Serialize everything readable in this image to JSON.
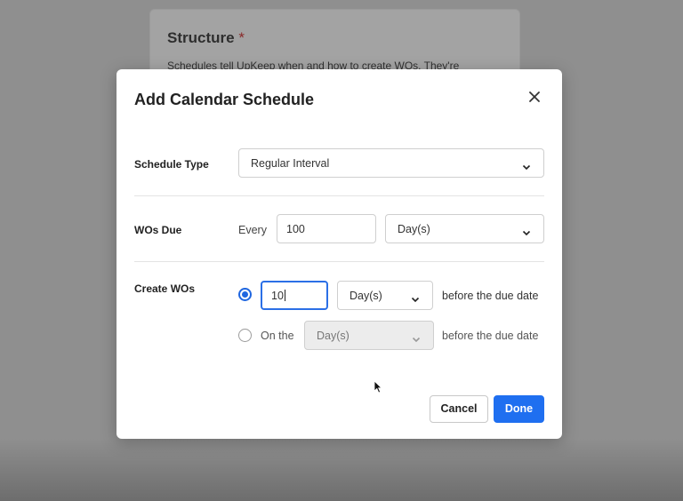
{
  "background": {
    "section_title": "Structure",
    "required_marker": "*",
    "description": "Schedules tell UpKeep when and how to create WOs. They're"
  },
  "modal": {
    "title": "Add Calendar Schedule",
    "close_icon": "close-icon",
    "schedule_type": {
      "label": "Schedule Type",
      "value": "Regular Interval"
    },
    "wos_due": {
      "label": "WOs Due",
      "every_text": "Every",
      "interval_value": "100",
      "unit_value": "Day(s)"
    },
    "create_wos": {
      "label": "Create WOs",
      "option1": {
        "selected": true,
        "amount_value": "10",
        "unit_value": "Day(s)",
        "suffix": "before the due date"
      },
      "option2": {
        "selected": false,
        "prefix": "On the",
        "unit_value": "Day(s)",
        "suffix": "before the due date",
        "disabled": true
      }
    },
    "buttons": {
      "cancel": "Cancel",
      "done": "Done"
    }
  },
  "colors": {
    "accent": "#1f6ff0",
    "overlay": "#8f8f8f"
  }
}
